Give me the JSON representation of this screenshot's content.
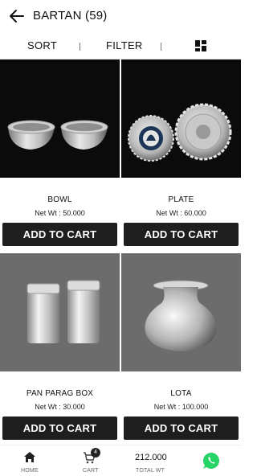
{
  "header": {
    "back_icon": "arrow-left-icon",
    "title": "BARTAN (59)"
  },
  "toolbar": {
    "sort_label": "SORT",
    "filter_label": "FILTER",
    "layout_icon": "grid-view-icon"
  },
  "products": [
    {
      "name": "BOWL",
      "weight": "Net Wt : 50.000",
      "button": "ADD TO CART"
    },
    {
      "name": "PLATE",
      "weight": "Net Wt : 60.000",
      "button": "ADD TO CART"
    },
    {
      "name": "PAN PARAG BOX",
      "weight": "Net Wt : 30.000",
      "button": "ADD TO CART"
    },
    {
      "name": "LOTA",
      "weight": "Net Wt : 100.000",
      "button": "ADD TO CART"
    }
  ],
  "bottom_nav": {
    "home_label": "HOME",
    "cart_label": "CART",
    "cart_count": "4",
    "total_value": "212.000",
    "total_label": "TOTAL WT",
    "whatsapp_icon": "whatsapp-icon"
  },
  "colors": {
    "button_bg": "#1e1e1e",
    "whatsapp": "#25d366"
  }
}
